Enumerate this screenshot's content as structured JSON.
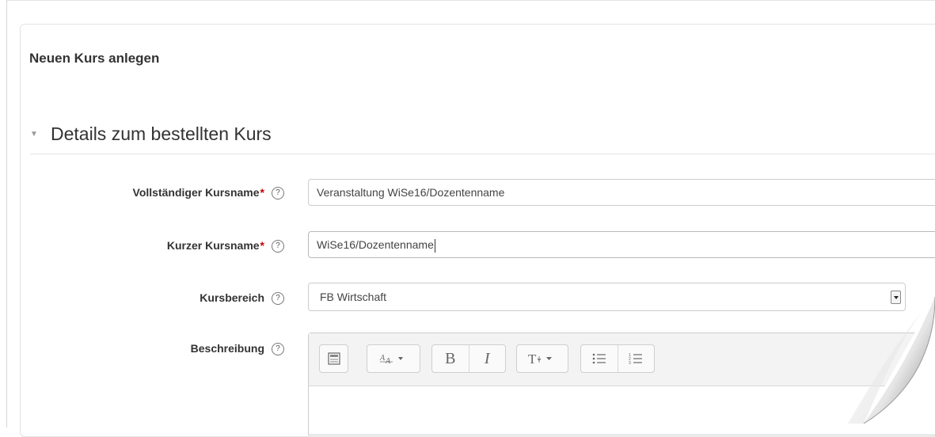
{
  "page": {
    "title": "Neuen Kurs anlegen"
  },
  "section": {
    "title": "Details zum bestellten Kurs",
    "expanded": true
  },
  "form": {
    "required_marker": "*",
    "help_glyph": "?",
    "fields": {
      "fullname": {
        "label": "Vollständiger Kursname",
        "value": "Veranstaltung WiSe16/Dozentenname",
        "required": true
      },
      "shortname": {
        "label": "Kurzer Kursname",
        "value": "WiSe16/Dozentenname",
        "required": true
      },
      "category": {
        "label": "Kursbereich",
        "value": "FB Wirtschaft"
      },
      "description": {
        "label": "Beschreibung"
      }
    }
  },
  "editor_toolbar": {
    "bold_label": "B",
    "italic_label": "I"
  },
  "colors": {
    "required": "#cc0000",
    "toolbar_bg": "#f3f3f3",
    "border": "#cccccc"
  },
  "icons": [
    "collapse-caret-icon",
    "help-icon",
    "dropdown-arrow-icon",
    "toolbar-toggle-icon",
    "font-style-icon",
    "text-format-icon",
    "bullet-list-icon",
    "numbered-list-icon",
    "page-curl"
  ]
}
